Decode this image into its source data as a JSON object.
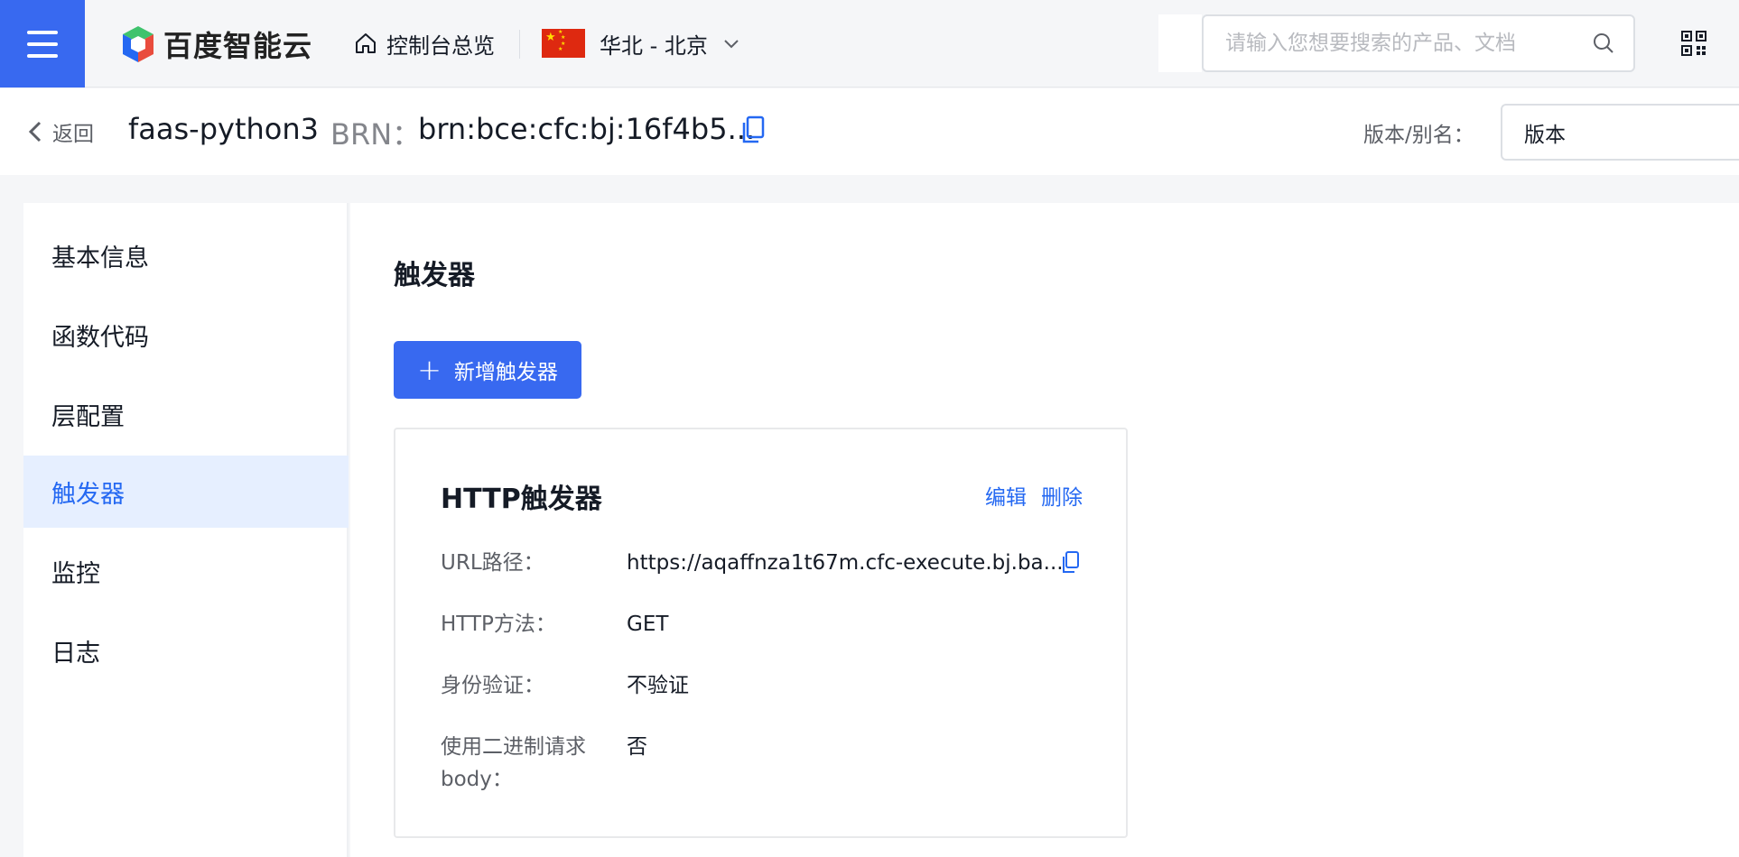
{
  "topbar": {
    "logo_text": "百度智能云",
    "home_label": "控制台总览",
    "region_label": "华北 - 北京",
    "search_placeholder": "请输入您想要搜索的产品、文档"
  },
  "header": {
    "back_label": "返回",
    "function_name": "faas-python3",
    "brn_label": "BRN：",
    "brn_value": "brn:bce:cfc:bj:16f4b5...",
    "version_label": "版本/别名：",
    "version_value": "版本"
  },
  "sidebar": {
    "items": [
      {
        "label": "基本信息"
      },
      {
        "label": "函数代码"
      },
      {
        "label": "层配置"
      },
      {
        "label": "触发器"
      },
      {
        "label": "监控"
      },
      {
        "label": "日志"
      }
    ],
    "active_index": 3
  },
  "main": {
    "section_title": "触发器",
    "add_button_label": "新增触发器",
    "trigger_card": {
      "title": "HTTP触发器",
      "edit_label": "编辑",
      "delete_label": "删除",
      "rows": [
        {
          "label": "URL路径：",
          "value": "https://aqaffnza1t67m.cfc-execute.bj.ba..."
        },
        {
          "label": "HTTP方法：",
          "value": "GET"
        },
        {
          "label": "身份验证：",
          "value": "不验证"
        },
        {
          "label": "使用二进制请求body：",
          "value": "否"
        }
      ]
    }
  },
  "colors": {
    "primary": "#3869f0",
    "link": "#2468f2",
    "active_bg": "#e6efff",
    "flag_red": "#de2910"
  }
}
